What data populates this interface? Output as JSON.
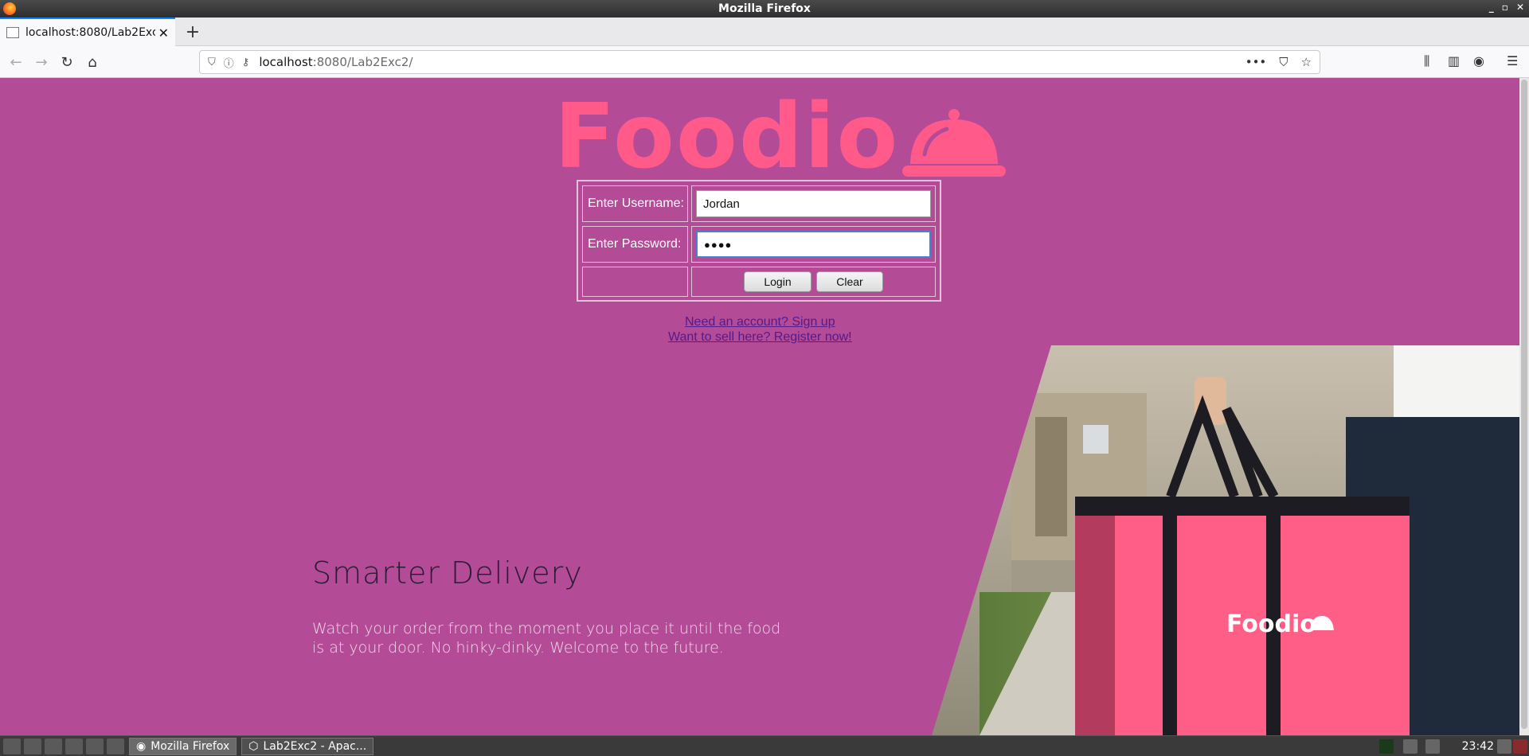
{
  "window": {
    "title": "Mozilla Firefox"
  },
  "tabs": [
    {
      "label": "localhost:8080/Lab2Exc2"
    }
  ],
  "navbar": {
    "url_host": "localhost",
    "url_path": ":8080/Lab2Exc2/"
  },
  "logo": {
    "text": "Foodio",
    "icon": "cloche-icon",
    "color": "#ff5a8a"
  },
  "login": {
    "username_label": "Enter Username:",
    "username_value": "Jordan",
    "password_label": "Enter Password:",
    "password_value": "●●●●",
    "login_label": "Login",
    "clear_label": "Clear"
  },
  "links": {
    "signup": "Need an account? Sign up",
    "register": "Want to sell here? Register now!"
  },
  "hero": {
    "title": "Smarter Delivery",
    "text": "Watch your order from the moment you place it until the food is at your door. No hinky-dinky. Welcome to the future.",
    "bag_logo": "Foodio"
  },
  "taskbar": {
    "tasks": [
      "Mozilla Firefox",
      "Lab2Exc2 - Apac..."
    ],
    "clock": "23:42"
  },
  "colors": {
    "page_bg": "#b34b97",
    "brand": "#ff5a8a",
    "link": "#551a8b"
  }
}
